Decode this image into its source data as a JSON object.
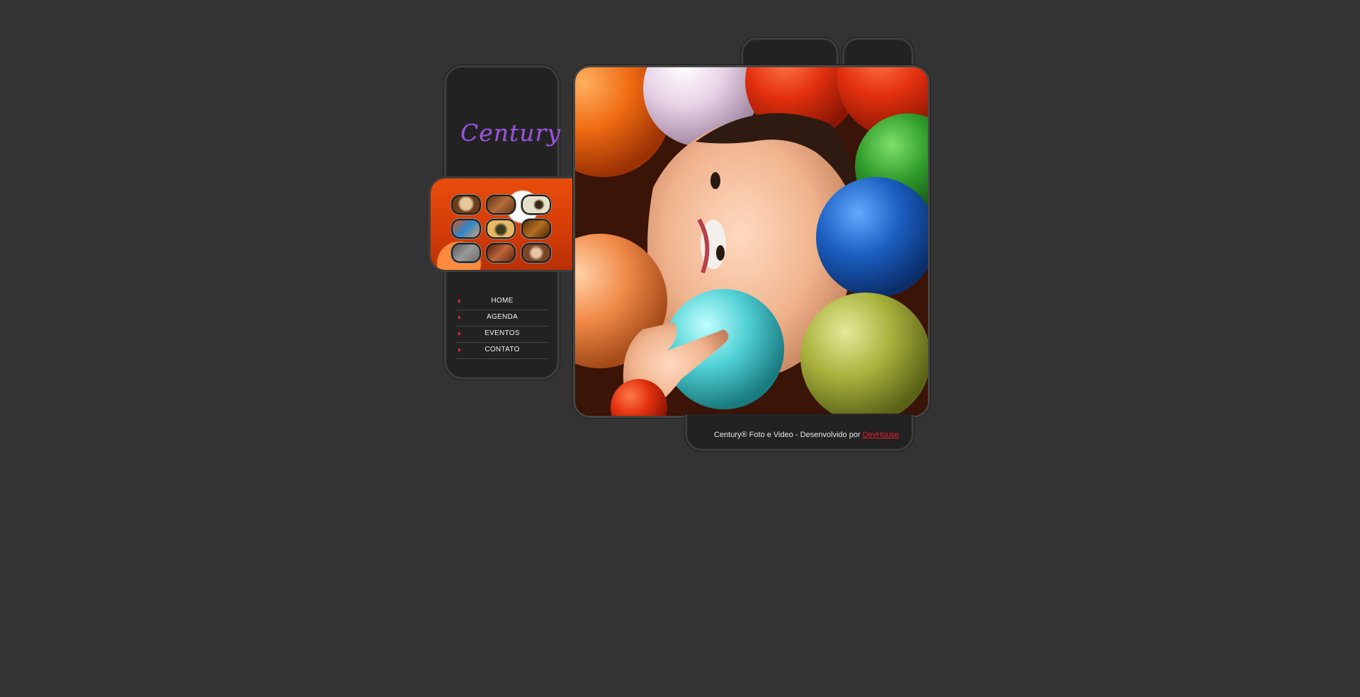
{
  "brand": {
    "logo_text": "Century"
  },
  "colors": {
    "background": "#333333",
    "panel": "#222222",
    "logo": "#9a55d6",
    "nav_arrow": "#e0243a",
    "link": "#e51a2b"
  },
  "gallery": {
    "thumbnails": [
      {
        "name": "thumb-1",
        "tone": "#c79a62"
      },
      {
        "name": "thumb-2",
        "tone": "#9b5a2c"
      },
      {
        "name": "thumb-3",
        "tone": "#d8d2bd"
      },
      {
        "name": "thumb-4",
        "tone": "#c05a3a"
      },
      {
        "name": "thumb-5",
        "tone": "#c69a4c"
      },
      {
        "name": "thumb-6",
        "tone": "#8c4a18"
      },
      {
        "name": "thumb-7",
        "tone": "#7c7c7c"
      },
      {
        "name": "thumb-8",
        "tone": "#8a3d1a"
      },
      {
        "name": "thumb-9",
        "tone": "#b87a52"
      }
    ]
  },
  "nav": {
    "items": [
      {
        "label": "HOME"
      },
      {
        "label": "AGENDA"
      },
      {
        "label": "EVENTOS"
      },
      {
        "label": "CONTATO"
      }
    ]
  },
  "footer": {
    "text": "Century® Foto e Video - Desenvolvido por ",
    "link_text": "DevHouse"
  }
}
